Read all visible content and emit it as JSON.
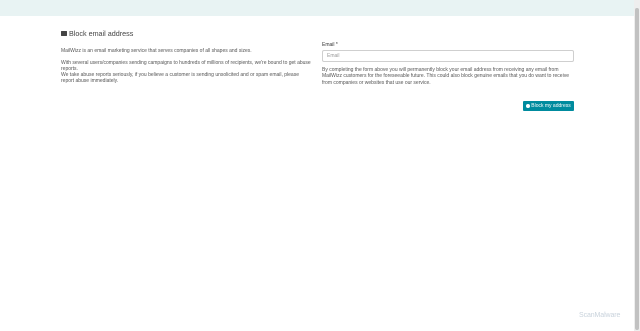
{
  "header": {
    "title": "Block email address",
    "title_icon": "envelope-icon"
  },
  "left": {
    "paragraph1": "MailWizz is an email marketing service that serves companies of all shapes and sizes.",
    "paragraph2": "With several users/companies sending campaigns to hundreds of millions of recipients, we're bound to get abuse reports.",
    "paragraph3": "We take abuse reports seriously, if you believe a customer is sending unsolicited and or spam email, please report abuse immediately."
  },
  "form": {
    "email_label": "Email",
    "required_mark": "*",
    "email_placeholder": "Email",
    "email_value": "",
    "description": "By completing the form above you will permanently block your email address from receiving any email from MailWizz customers for the foreseeable future. This could also block genuine emails that you do want to receive from companies or websites that use our service.",
    "submit_label": "Block my address",
    "submit_icon": "circle-check-icon"
  },
  "watermark": {
    "text": "ScanMalware"
  },
  "colors": {
    "topbar": "#e8f3f3",
    "button": "#008b9e",
    "text": "#555555"
  }
}
